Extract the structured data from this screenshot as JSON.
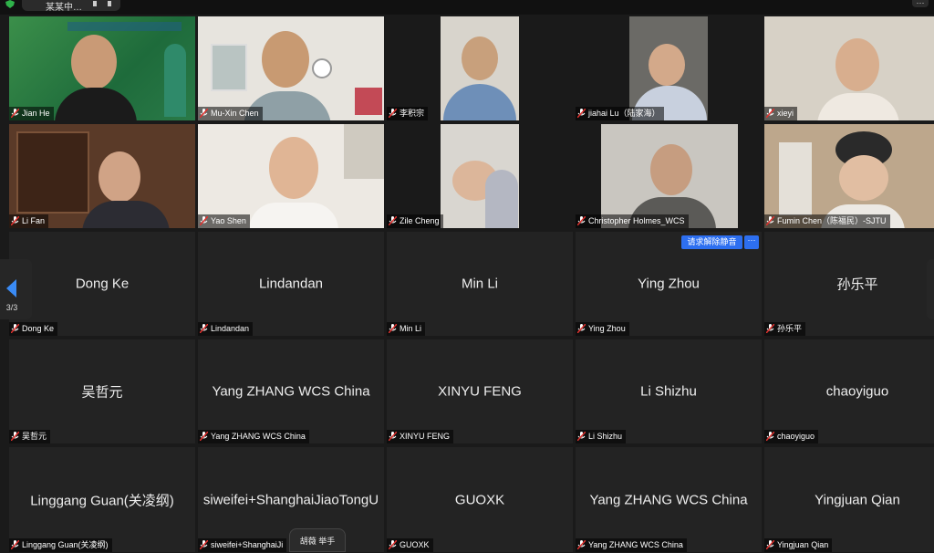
{
  "topbar": {
    "meeting_title": "某某中…"
  },
  "pager": {
    "page": "3/3"
  },
  "active_tile": {
    "unmute_request": "请求解除静音",
    "more": "···"
  },
  "raise_hand": {
    "text": "胡薇 举手"
  },
  "tiles": [
    {
      "name": "Jian He",
      "center": ""
    },
    {
      "name": "Mu-Xin Chen",
      "center": ""
    },
    {
      "name": "李积宗",
      "center": ""
    },
    {
      "name": "jiahai Lu（陆家海）",
      "center": ""
    },
    {
      "name": "xieyi",
      "center": ""
    },
    {
      "name": "Li  Fan",
      "center": ""
    },
    {
      "name": "Yao Shen",
      "center": ""
    },
    {
      "name": "Zile Cheng",
      "center": ""
    },
    {
      "name": "Christopher Holmes_WCS",
      "center": ""
    },
    {
      "name": "Fumin Chen（陈福民）-SJTU",
      "center": ""
    },
    {
      "name": "Dong Ke",
      "center": "Dong Ke"
    },
    {
      "name": "Lindandan",
      "center": "Lindandan"
    },
    {
      "name": "Min Li",
      "center": "Min Li"
    },
    {
      "name": "Ying Zhou",
      "center": "Ying Zhou"
    },
    {
      "name": "孙乐平",
      "center": "孙乐平"
    },
    {
      "name": "吴哲元",
      "center": "吴哲元"
    },
    {
      "name": "Yang ZHANG WCS China",
      "center": "Yang ZHANG WCS China"
    },
    {
      "name": "XINYU FENG",
      "center": "XINYU FENG"
    },
    {
      "name": "Li Shizhu",
      "center": "Li Shizhu"
    },
    {
      "name": "chaoyiguo",
      "center": "chaoyiguo"
    },
    {
      "name": "Linggang Guan(关凌纲)",
      "center": "Linggang Guan(关凌纲)"
    },
    {
      "name": "siweifei+ShanghaiJi",
      "center": "siweifei+ShanghaiJiaoTongU"
    },
    {
      "name": "GUOXK",
      "center": "GUOXK"
    },
    {
      "name": "Yang ZHANG WCS China",
      "center": "Yang ZHANG WCS China"
    },
    {
      "name": "Yingjuan Qian",
      "center": "Yingjuan Qian"
    }
  ],
  "icons": {
    "muted_mic": "muted-mic-icon",
    "security": "shield-icon",
    "page_prev": "chevron-left-icon"
  },
  "colors": {
    "accent": "#2d6ff0",
    "muted": "#e0312e",
    "tile_bg": "#232323",
    "bg": "#1a1a1a"
  }
}
